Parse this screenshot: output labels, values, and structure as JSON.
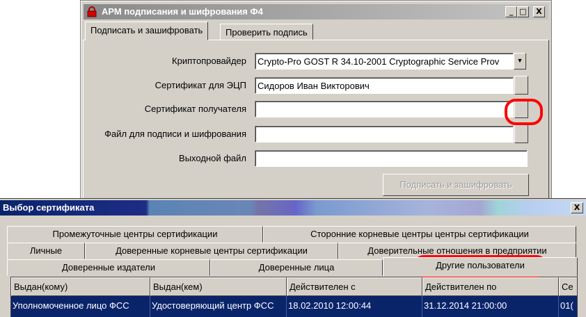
{
  "main_window": {
    "title": "АРМ подписания и шифрования Ф4",
    "controls": {
      "minimize": "_",
      "maximize": "□",
      "close": "X"
    },
    "tabs": [
      {
        "label": "Подписать и зашифровать",
        "active": true
      },
      {
        "label": "Проверить подпись",
        "active": false
      }
    ],
    "form": {
      "provider_label": "Криптопровайдер",
      "provider_value": "Crypto-Pro GOST R 34.10-2001 Cryptographic Service Prov",
      "signer_cert_label": "Сертификат для ЭЦП",
      "signer_cert_value": "Сидоров Иван Викторович",
      "recipient_cert_label": "Сертификат получателя",
      "recipient_cert_value": "",
      "input_file_label": "Файл для подписи и шифрования",
      "input_file_value": "",
      "output_file_label": "Выходной файл",
      "output_file_value": ""
    },
    "sign_button": "Подписать и зашифровать"
  },
  "cert_dialog": {
    "title": "Выбор сертификата",
    "close": "X",
    "tabs_row1": [
      "Промежуточные центры сертификации",
      "Сторонние корневые центры центры сертификации"
    ],
    "tabs_row2": [
      "Личные",
      "Доверенные корневые центры сертификации",
      "Доверительные отношения в предприятии"
    ],
    "tabs_row3": [
      "Доверенные издатели",
      "Доверенные лица",
      "Другие пользователи"
    ],
    "active_tab": "Другие пользователи",
    "columns": [
      "Выдан(кому)",
      "Выдан(кем)",
      "Действителен с",
      "Действителен по",
      "Се"
    ],
    "rows": [
      [
        "Уполномоченное лицо ФСС",
        "Удостоверяющий центр ФСС",
        "18.02.2010 12:00:44",
        "31.12.2014 21:00:00",
        "01("
      ]
    ]
  },
  "colors": {
    "window_face": "#d4d0c8",
    "selection": "#0a246a",
    "annotation": "#ff0000"
  }
}
